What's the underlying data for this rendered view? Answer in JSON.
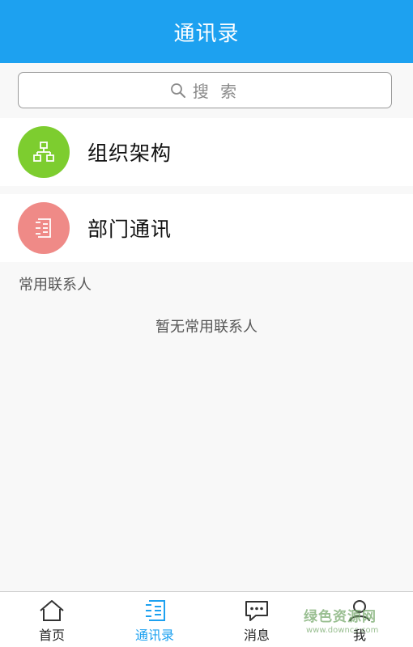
{
  "header": {
    "title": "通讯录"
  },
  "search": {
    "placeholder": "搜 索"
  },
  "rows": [
    {
      "label": "组织架构",
      "icon": "org-chart-icon",
      "color": "#7dcd2f"
    },
    {
      "label": "部门通讯",
      "icon": "list-icon",
      "color": "#ef8a87"
    }
  ],
  "frequent": {
    "section_label": "常用联系人",
    "empty_text": "暂无常用联系人"
  },
  "tabs": [
    {
      "label": "首页",
      "icon": "home-icon",
      "active": false
    },
    {
      "label": "通讯录",
      "icon": "contacts-icon",
      "active": true
    },
    {
      "label": "消息",
      "icon": "message-icon",
      "active": false
    },
    {
      "label": "我",
      "icon": "user-icon",
      "active": false
    }
  ],
  "watermark": {
    "text": "绿色资源网",
    "sub": "www.downcc.com"
  },
  "colors": {
    "accent": "#1da1f0",
    "background": "#f8f8f8"
  }
}
